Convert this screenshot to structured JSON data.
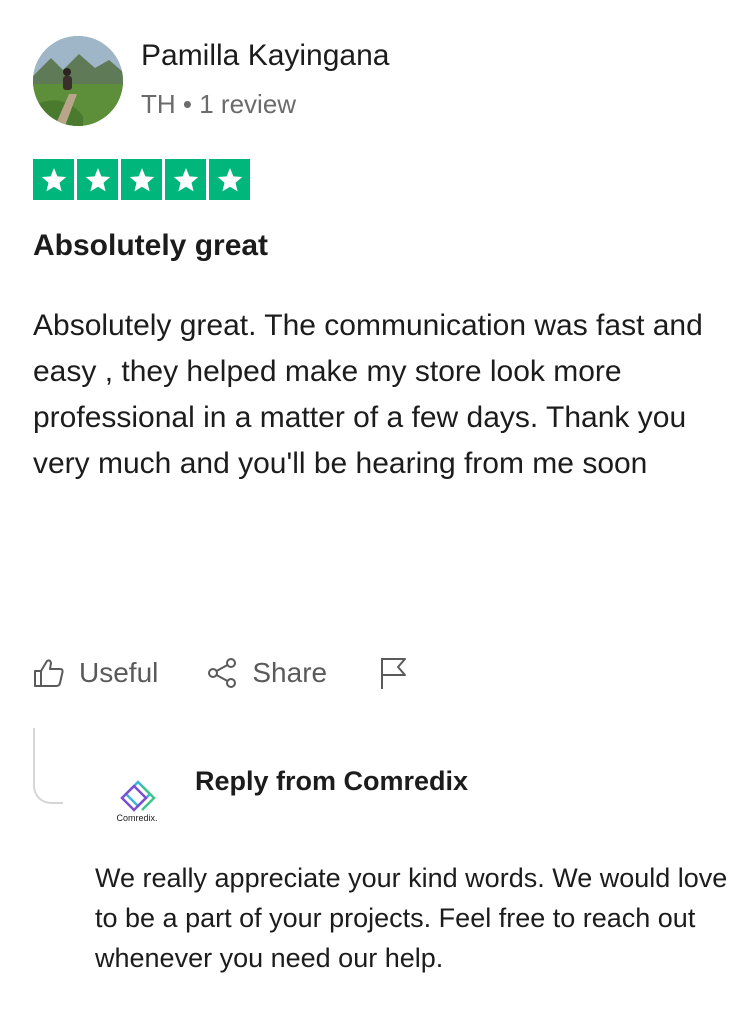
{
  "review": {
    "reviewer_name": "Pamilla Kayingana",
    "reviewer_country": "TH",
    "reviewer_review_count": "1 review",
    "meta_separator": "•",
    "rating": 5,
    "rating_max": 5,
    "title": "Absolutely great",
    "body": "Absolutely great. The communication was fast and easy , they helped make my store look more professional in a matter of a few days. Thank you very much and you'll be hearing from me soon"
  },
  "actions": {
    "useful_label": "Useful",
    "share_label": "Share",
    "report_icon": "flag-icon"
  },
  "reply": {
    "title": "Reply from Comredix",
    "company_logo_text": "Comredix.",
    "body": "We really appreciate your kind words. We would love to be a part of your projects. Feel free to reach out whenever you need our help."
  },
  "colors": {
    "star_green": "#00b67a",
    "text_primary": "#1c1c1c",
    "text_secondary": "#6b6b6b"
  }
}
